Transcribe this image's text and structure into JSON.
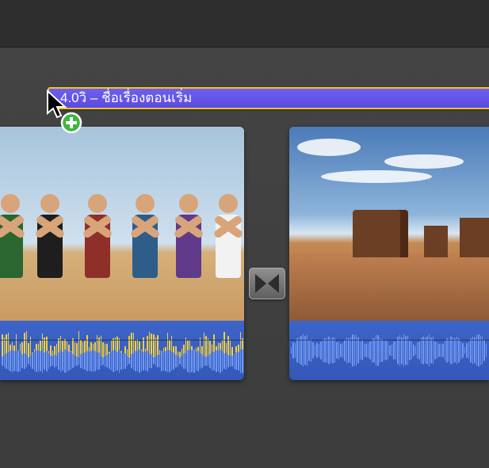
{
  "title_overlay": {
    "label": "4.0วิ – ชื่อเรื่องตอนเริ่ม"
  },
  "icons": {
    "cursor": "arrow-cursor-icon",
    "add_badge": "plus-badge-icon",
    "transition": "cross-dissolve-icon"
  }
}
